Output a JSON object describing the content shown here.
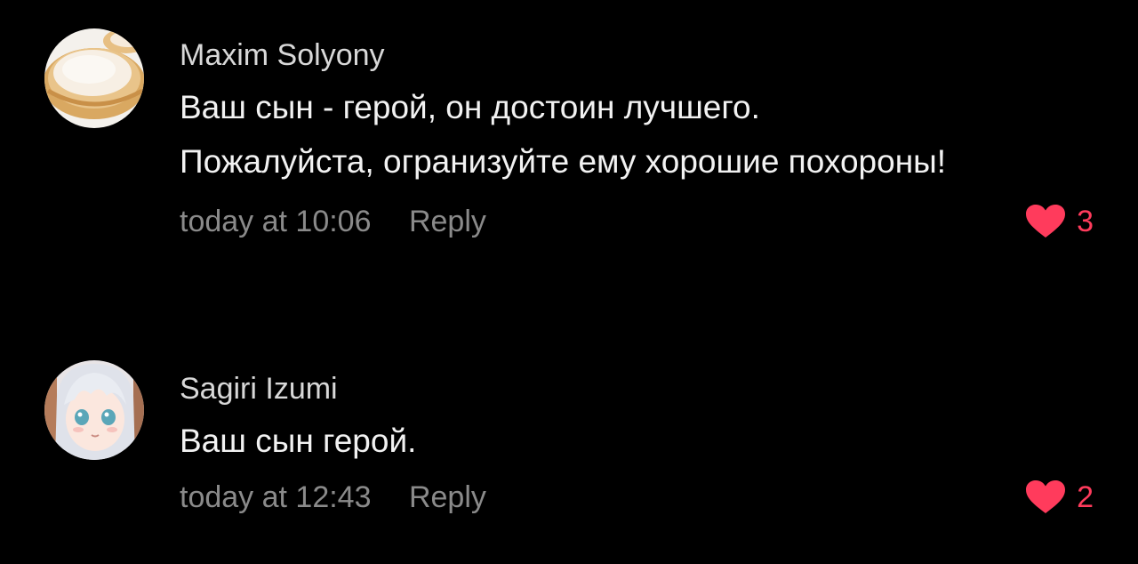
{
  "accent_color": "#ff3b5c",
  "comments": [
    {
      "author": "Maxim Solyony",
      "avatar_icon": "pastry-avatar",
      "text": "Ваш сын - герой, он достоин лучшего. Пожалуйста, огранизуйте ему хорошие похороны!",
      "timestamp": "today at 10:06",
      "reply_label": "Reply",
      "like_icon": "heart-icon",
      "likes": "3"
    },
    {
      "author": "Sagiri Izumi",
      "avatar_icon": "anime-girl-avatar",
      "text": "Ваш сын герой.",
      "timestamp": "today at 12:43",
      "reply_label": "Reply",
      "like_icon": "heart-icon",
      "likes": "2"
    }
  ]
}
